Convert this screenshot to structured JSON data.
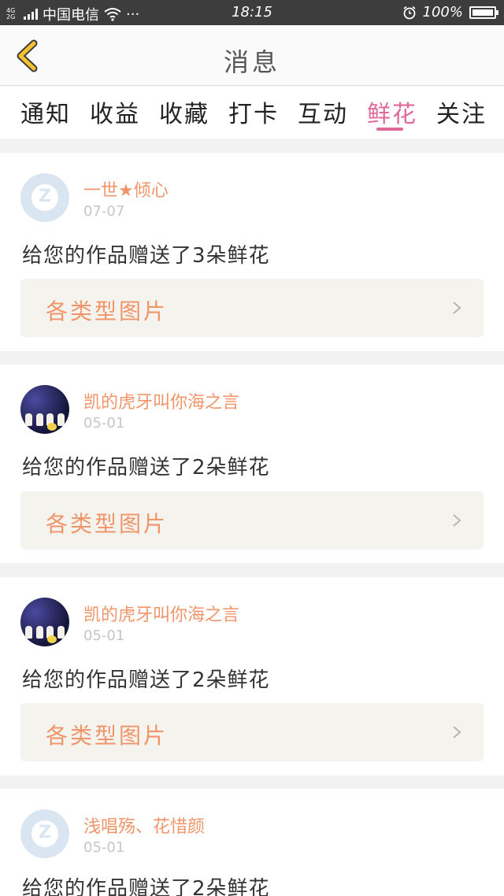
{
  "status": {
    "network": "4G\n2G",
    "carrier": "中国电信",
    "more": "···",
    "time": "18:15",
    "battery": "100%"
  },
  "header": {
    "title": "消息"
  },
  "tabs": [
    {
      "label": "通知"
    },
    {
      "label": "收益"
    },
    {
      "label": "收藏"
    },
    {
      "label": "打卡"
    },
    {
      "label": "互动"
    },
    {
      "label": "鲜花",
      "active": true
    },
    {
      "label": "关注"
    }
  ],
  "messages": [
    {
      "name": "一世★倾心",
      "date": "07-07",
      "text": "给您的作品赠送了3朵鲜花",
      "link": "各类型图片"
    },
    {
      "name": "凯的虎牙叫你海之言",
      "date": "05-01",
      "text": "给您的作品赠送了2朵鲜花",
      "link": "各类型图片"
    },
    {
      "name": "凯的虎牙叫你海之言",
      "date": "05-01",
      "text": "给您的作品赠送了2朵鲜花",
      "link": "各类型图片"
    },
    {
      "name": "浅唱殇、花惜颜",
      "date": "05-01",
      "text": "给您的作品赠送了2朵鲜花"
    }
  ],
  "colors": {
    "accent_pink": "#e0679a",
    "name_orange": "#f0956a",
    "back_yellow": "#f2c230"
  }
}
